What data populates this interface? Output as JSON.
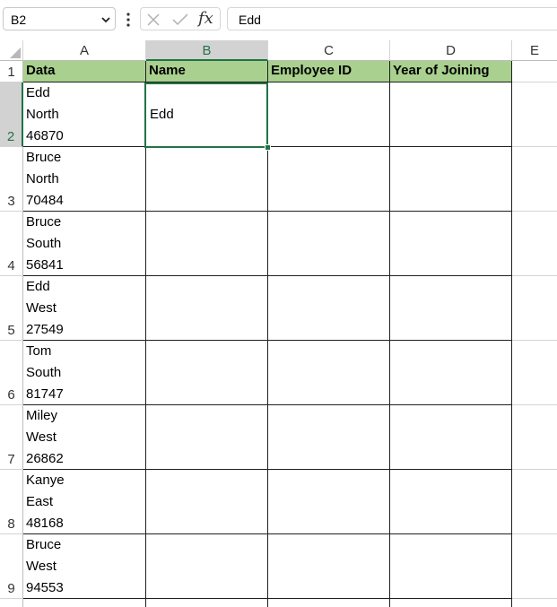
{
  "formula_bar": {
    "name_box": "B2",
    "formula": "Edd",
    "fx_label": "fx",
    "icons": [
      "chevron-down-icon",
      "more-vertical-icon",
      "cancel-x-icon",
      "confirm-check-icon",
      "function-icon"
    ]
  },
  "columns": [
    "A",
    "B",
    "C",
    "D",
    "E"
  ],
  "headers": [
    "Data",
    "Name",
    "Employee ID",
    "Year of Joining"
  ],
  "rows": [
    {
      "num": "1"
    },
    {
      "num": "2",
      "data": [
        "Edd",
        "North",
        "46870"
      ],
      "name": "Edd"
    },
    {
      "num": "3",
      "data": [
        "Bruce",
        "North",
        "70484"
      ],
      "name": ""
    },
    {
      "num": "4",
      "data": [
        "Bruce",
        "South",
        "56841"
      ],
      "name": ""
    },
    {
      "num": "5",
      "data": [
        "Edd",
        "West",
        "27549"
      ],
      "name": ""
    },
    {
      "num": "6",
      "data": [
        "Tom",
        "South",
        "81747"
      ],
      "name": ""
    },
    {
      "num": "7",
      "data": [
        "Miley",
        "West",
        "26862"
      ],
      "name": ""
    },
    {
      "num": "8",
      "data": [
        "Kanye",
        "East",
        "48168"
      ],
      "name": ""
    },
    {
      "num": "9",
      "data": [
        "Bruce",
        "West",
        "94553"
      ],
      "name": ""
    }
  ],
  "colors": {
    "header_fill": "#a9d08e",
    "selection": "#217346"
  }
}
